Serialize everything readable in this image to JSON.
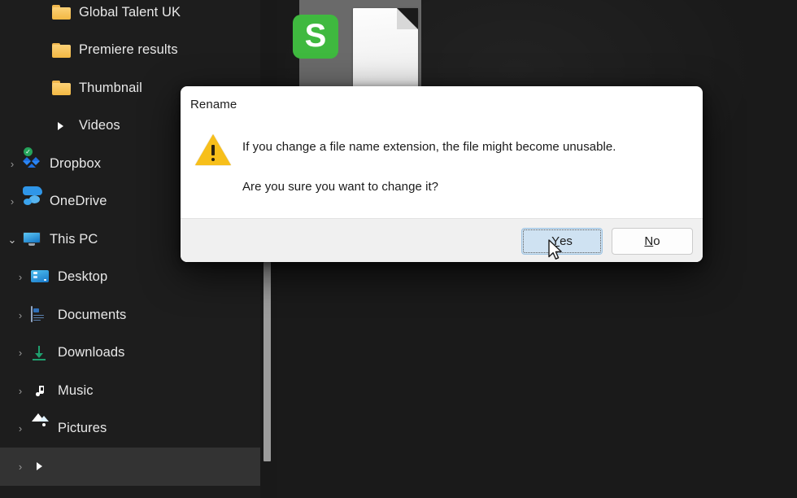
{
  "navigation_pane": {
    "scrollbar": {
      "name": "vertical-scrollbar"
    },
    "items": [
      {
        "label": "Global Talent UK",
        "icon": "folder-icon",
        "level": 1,
        "expander": "none",
        "selected": false
      },
      {
        "label": "Premiere results",
        "icon": "folder-icon",
        "level": 1,
        "expander": "none",
        "selected": false
      },
      {
        "label": "Thumbnail",
        "icon": "folder-icon",
        "level": 1,
        "expander": "none",
        "selected": false
      },
      {
        "label": "Videos",
        "icon": "video-icon",
        "level": 1,
        "expander": "none",
        "selected": false
      },
      {
        "label": "Dropbox",
        "icon": "dropbox-icon",
        "level": 0,
        "expander": "collapsed",
        "selected": false
      },
      {
        "label": "OneDrive",
        "icon": "onedrive-icon",
        "level": 0,
        "expander": "collapsed",
        "selected": false
      },
      {
        "label": "This PC",
        "icon": "this-pc-icon",
        "level": 0,
        "expander": "expanded",
        "selected": false
      },
      {
        "label": "Desktop",
        "icon": "desktop-icon",
        "level": 2,
        "expander": "collapsed",
        "selected": false
      },
      {
        "label": "Documents",
        "icon": "documents-icon",
        "level": 2,
        "expander": "collapsed",
        "selected": false
      },
      {
        "label": "Downloads",
        "icon": "downloads-icon",
        "level": 2,
        "expander": "collapsed",
        "selected": false
      },
      {
        "label": "Music",
        "icon": "music-icon",
        "level": 2,
        "expander": "collapsed",
        "selected": false
      },
      {
        "label": "Pictures",
        "icon": "pictures-icon",
        "level": 2,
        "expander": "collapsed",
        "selected": false
      },
      {
        "label": "",
        "icon": "videos-icon",
        "level": 2,
        "expander": "collapsed",
        "selected": true
      }
    ],
    "expander_glyphs": {
      "collapsed": "›",
      "expanded": "⌄"
    }
  },
  "content_pane": {
    "selected_file": {
      "name": "selected-file-thumbnail",
      "badge_letter": "S",
      "badge_color": "#3fb93f"
    }
  },
  "dialog": {
    "title": "Rename",
    "icon": "warning-triangle-icon",
    "message_line_1": "If you change a file name extension, the file might become unusable.",
    "message_line_2": "Are you sure you want to change it?",
    "buttons": {
      "yes": {
        "accel": "Y",
        "rest": "es",
        "focused": true
      },
      "no": {
        "accel": "N",
        "rest": "o",
        "focused": false
      }
    }
  },
  "colors": {
    "window_background": "#1a1a1a",
    "nav_background": "#1d1d1d",
    "nav_text": "#e8e8e8",
    "dialog_background": "#ffffff",
    "dialog_footer": "#f0f0f0",
    "warning_yellow": "#f7bf1a",
    "focus_button_fill": "#cfe2f2",
    "scrollbar_thumb": "#9b9b9b"
  }
}
